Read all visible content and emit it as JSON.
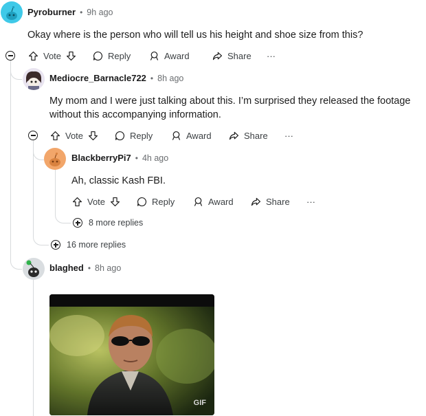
{
  "comments": [
    {
      "username": "Pyroburner",
      "time": "9h ago",
      "body": "Okay where is the person who will tell us his height and shoe size from this?"
    },
    {
      "username": "Mediocre_Barnacle722",
      "time": "8h ago",
      "body_lines": [
        "My mom and I were just talking about this. I’m surprised they released the footage",
        "without this accompanying information."
      ]
    },
    {
      "username": "BlackberryPi7",
      "time": "4h ago",
      "body": "Ah, classic Kash FBI."
    },
    {
      "username": "blaghed",
      "time": "8h ago",
      "gif_label": "GIF"
    }
  ],
  "actions": {
    "vote": "Vote",
    "reply": "Reply",
    "award": "Award",
    "share": "Share",
    "more": "···"
  },
  "more_replies": {
    "nested": "8 more replies",
    "top": "16 more replies"
  },
  "separator": "•",
  "colors": {
    "accent_avatar_1": "#3fc9e8",
    "accent_avatar_3": "#f2a66a",
    "thread_line": "#d7dadc"
  }
}
